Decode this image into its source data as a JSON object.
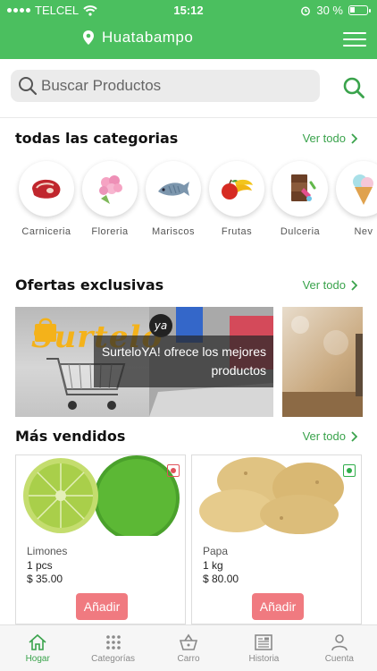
{
  "status_bar": {
    "carrier": "TELCEL",
    "time": "15:12",
    "battery": "30 %",
    "battery_level": 0.3
  },
  "header": {
    "location": "Huatabampo"
  },
  "search": {
    "placeholder": "Buscar Productos"
  },
  "categories_section": {
    "title": "todas las categorias",
    "see_all": "Ver todo",
    "items": [
      {
        "label": "Carniceria",
        "icon": "steak-icon"
      },
      {
        "label": "Floreria",
        "icon": "flowers-icon"
      },
      {
        "label": "Mariscos",
        "icon": "fish-icon"
      },
      {
        "label": "Frutas",
        "icon": "fruits-icon"
      },
      {
        "label": "Dulceria",
        "icon": "candy-icon"
      },
      {
        "label": "Nev",
        "icon": "ice-cream-icon"
      }
    ]
  },
  "offers_section": {
    "title": "Ofertas exclusivas",
    "see_all": "Ver todo",
    "banner": {
      "brand": "Surtelo",
      "brand_badge": "ya",
      "text": "SurteloYA! ofrece los mejores productos"
    }
  },
  "bestsellers_section": {
    "title": "Más vendidos",
    "see_all": "Ver todo",
    "products": [
      {
        "name": "Limones",
        "qty": "1 pcs",
        "price": "$ 35.00",
        "add_label": "Añadir",
        "badge_color": "#e0525a"
      },
      {
        "name": "Papa",
        "qty": "1 kg",
        "price": "$ 80.00",
        "add_label": "Añadir",
        "badge_color": "#2fae4a"
      }
    ]
  },
  "bottom_nav": {
    "active": "Hogar",
    "items": [
      {
        "label": "Hogar",
        "icon": "home-icon"
      },
      {
        "label": "Categorías",
        "icon": "grid-icon"
      },
      {
        "label": "Carro",
        "icon": "basket-icon"
      },
      {
        "label": "Historia",
        "icon": "newspaper-icon"
      },
      {
        "label": "Cuenta",
        "icon": "user-icon"
      }
    ]
  },
  "colors": {
    "brand_green": "#4bbf5f",
    "link_green": "#3aa34c",
    "add_button": "#f07a80"
  }
}
